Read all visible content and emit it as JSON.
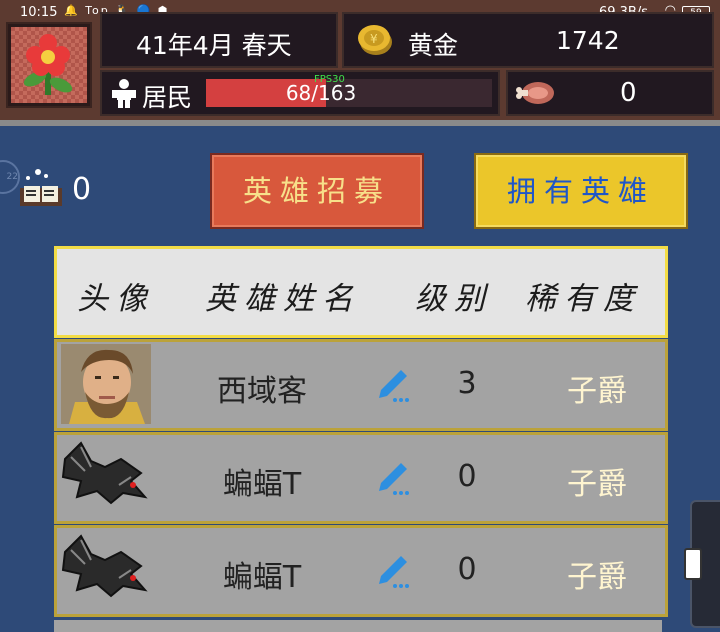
{
  "status_bar": {
    "time": "10:15",
    "icons": "🔔 Top 🐧 🔵 ⬢",
    "net_speed": "69.3B/s",
    "battery": "59"
  },
  "header": {
    "date": "41年4月 春天",
    "gold_label": "黄金",
    "gold_value": "1742",
    "residents_label": "居民",
    "residents_text": "68/163",
    "residents_fraction": 0.417,
    "fps": "FPS30",
    "meat_value": "0"
  },
  "book_count": "0",
  "side_badge": "22",
  "buttons": {
    "recruit": "英雄招募",
    "owned": "拥有英雄"
  },
  "table": {
    "headers": [
      "头像",
      "英雄姓名",
      "级别",
      "稀有度"
    ],
    "rows": [
      {
        "portrait": "bearded-man-portrait",
        "name": "西域客",
        "level": "3",
        "rarity": "子爵"
      },
      {
        "portrait": "bat-portrait",
        "name": "蝙蝠T",
        "level": "0",
        "rarity": "子爵"
      },
      {
        "portrait": "bat-portrait",
        "name": "蝙蝠T",
        "level": "0",
        "rarity": "子爵"
      }
    ]
  },
  "colors": {
    "background": "#2e4a78",
    "recruit_button": "#d8583c",
    "owned_button": "#ebc62a",
    "header_border": "#f2dc46",
    "rarity_text": "#fff5d0",
    "pencil_icon": "#2d8fe0"
  }
}
